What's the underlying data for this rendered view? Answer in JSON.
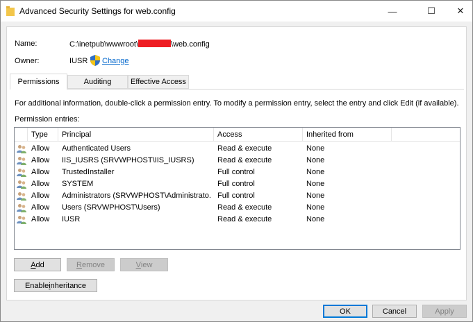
{
  "window": {
    "title": "Advanced Security Settings for web.config",
    "controls": {
      "minimize": "—",
      "maximize": "☐",
      "close": "✕"
    }
  },
  "name": {
    "label": "Name:",
    "prefix": "C:\\inetpub\\wwwroot\\",
    "suffix": "\\web.config"
  },
  "owner": {
    "label": "Owner:",
    "value": "IUSR",
    "change_label": "Change"
  },
  "tabs": [
    {
      "label": "Permissions",
      "active": true
    },
    {
      "label": "Auditing",
      "active": false
    },
    {
      "label": "Effective Access",
      "active": false
    }
  ],
  "info_text": "For additional information, double-click a permission entry. To modify a permission entry, select the entry and click Edit (if available).",
  "entries_label": "Permission entries:",
  "columns": {
    "type": "Type",
    "principal": "Principal",
    "access": "Access",
    "inherited": "Inherited from"
  },
  "entries": [
    {
      "type": "Allow",
      "principal": "Authenticated Users",
      "access": "Read & execute",
      "inherited": "None"
    },
    {
      "type": "Allow",
      "principal": "IIS_IUSRS (SRVWPHOST\\IIS_IUSRS)",
      "access": "Read & execute",
      "inherited": "None"
    },
    {
      "type": "Allow",
      "principal": "TrustedInstaller",
      "access": "Full control",
      "inherited": "None"
    },
    {
      "type": "Allow",
      "principal": "SYSTEM",
      "access": "Full control",
      "inherited": "None"
    },
    {
      "type": "Allow",
      "principal": "Administrators (SRVWPHOST\\Administrato...",
      "access": "Full control",
      "inherited": "None"
    },
    {
      "type": "Allow",
      "principal": "Users (SRVWPHOST\\Users)",
      "access": "Read & execute",
      "inherited": "None"
    },
    {
      "type": "Allow",
      "principal": "IUSR",
      "access": "Read & execute",
      "inherited": "None"
    }
  ],
  "buttons": {
    "add": {
      "u": "A",
      "rest": "dd"
    },
    "remove": {
      "u": "R",
      "rest": "emove"
    },
    "view": {
      "u": "V",
      "rest": "iew"
    },
    "enable_inheritance": {
      "pre": "Enable ",
      "u": "i",
      "rest": "nheritance"
    },
    "ok": "OK",
    "cancel": "Cancel",
    "apply": "Apply"
  },
  "icons": {
    "title": "folder-icon",
    "owner": "uac-shield-icon",
    "entry": "users-group-icon"
  },
  "colors": {
    "link": "#0066cc",
    "redaction": "#ee1d23",
    "ok_border": "#0078d7"
  }
}
